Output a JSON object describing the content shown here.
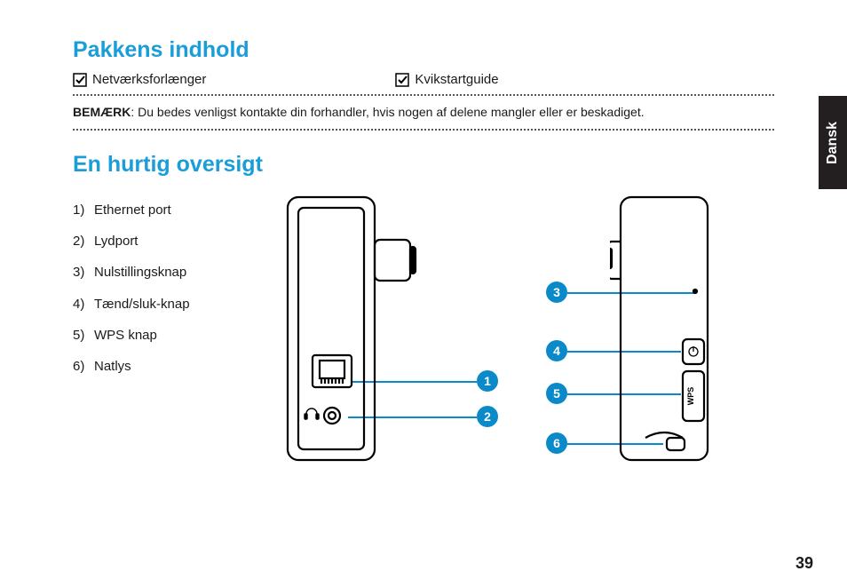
{
  "language_tab": "Dansk",
  "page_number": "39",
  "section1": {
    "heading": "Pakkens indhold",
    "items": [
      "Netværksforlænger",
      "Kvikstartguide"
    ],
    "note_label": "BEMÆRK",
    "note_text": ":  Du bedes venligst kontakte din forhandler, hvis nogen af delene mangler eller er beskadiget."
  },
  "section2": {
    "heading": "En hurtig oversigt",
    "legend": [
      "Ethernet port",
      "Lydport",
      "Nulstillingsknap",
      "Tænd/sluk-knap",
      "WPS knap",
      "Natlys"
    ],
    "callouts": [
      "1",
      "2",
      "3",
      "4",
      "5",
      "6"
    ],
    "wps_label": "WPS"
  }
}
